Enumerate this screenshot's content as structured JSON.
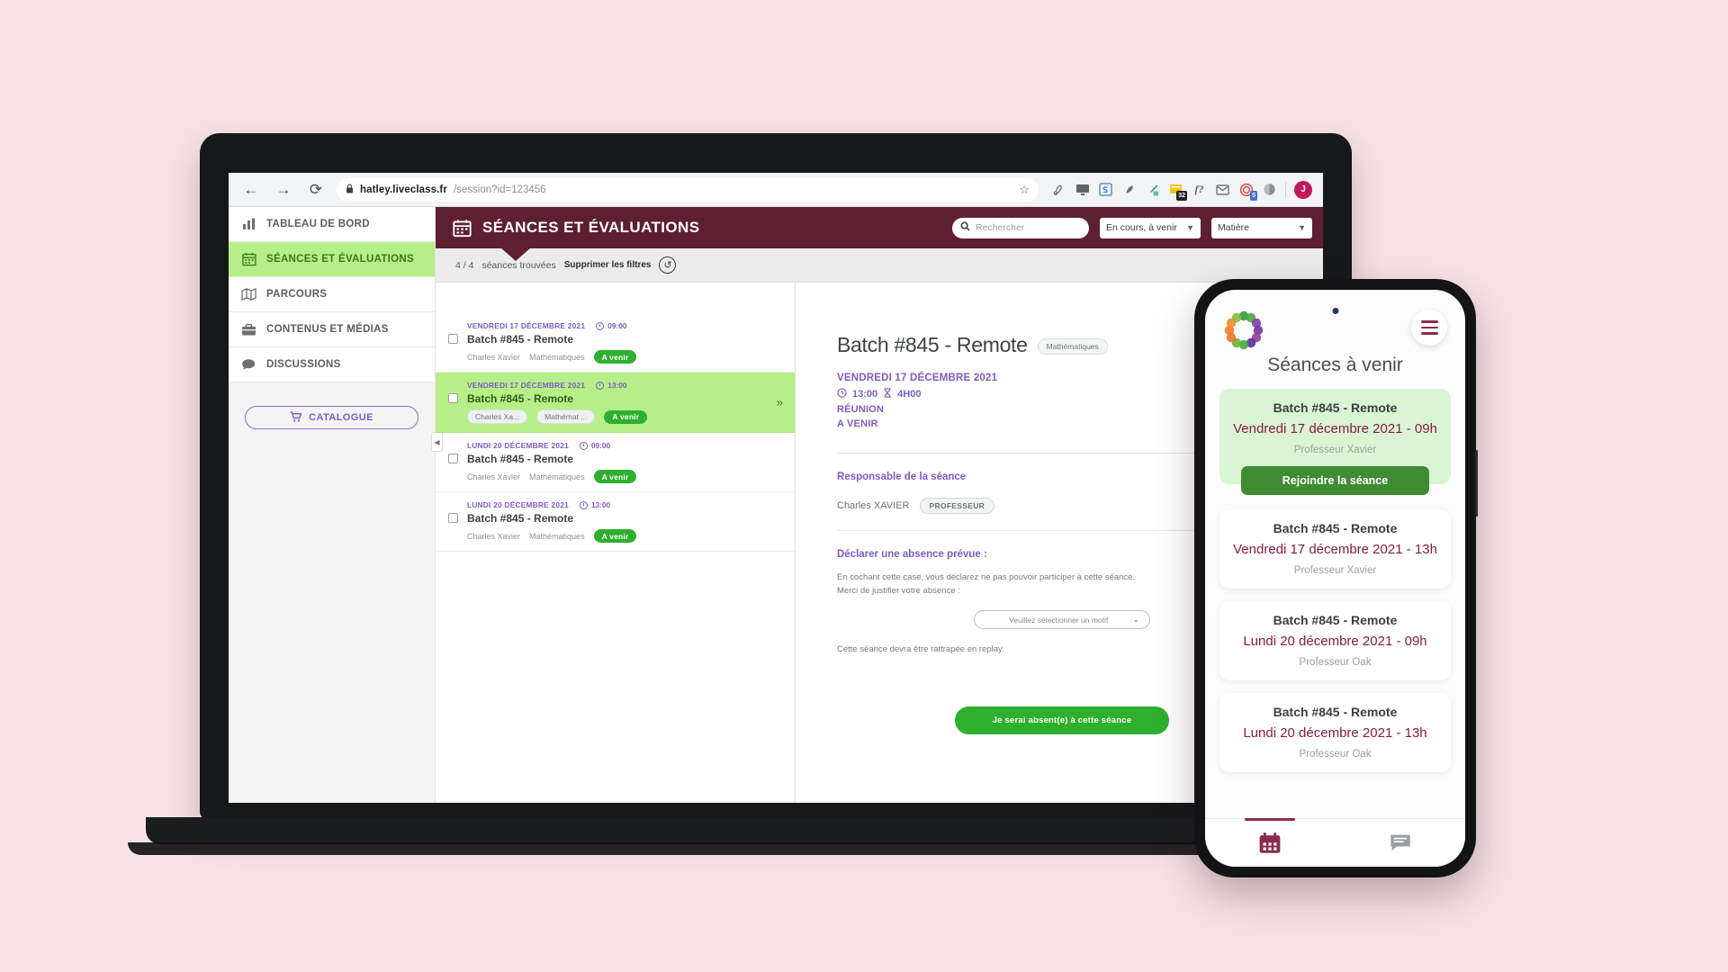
{
  "browser": {
    "url_host": "hatley.liveclass.fr",
    "url_path": "/session?id=123456",
    "back_icon": "←",
    "forward_icon": "→",
    "reload_icon": "⟳",
    "lock_icon": "🔒",
    "star_icon": "☆",
    "profile_initial": "J",
    "extension_badge_count": "5",
    "extension_note_count": "32"
  },
  "sidebar": {
    "items": [
      {
        "label": "TABLEAU DE BORD",
        "icon": "bar-chart-icon",
        "active": false
      },
      {
        "label": "SÉANCES ET ÉVALUATIONS",
        "icon": "calendar-icon",
        "active": true
      },
      {
        "label": "PARCOURS",
        "icon": "map-icon",
        "active": false
      },
      {
        "label": "CONTENUS ET MÉDIAS",
        "icon": "briefcase-icon",
        "active": false
      },
      {
        "label": "DISCUSSIONS",
        "icon": "chat-icon",
        "active": false
      }
    ],
    "catalogue_label": "CATALOGUE",
    "collapse_icon": "◀"
  },
  "topbar": {
    "title": "SÉANCES ET ÉVALUATIONS",
    "calendar_icon": "calendar-icon",
    "search_placeholder": "Rechercher",
    "search_value": "",
    "filter_status": "En cours, à venir",
    "filter_subject": "Matière"
  },
  "filterbar": {
    "count": "4 / 4",
    "count_label": "séances trouvées",
    "clear_label": "Supprimer les filtres",
    "reset_icon": "↺"
  },
  "sessions": [
    {
      "date": "VENDREDI 17 DÉCEMBRE 2021",
      "time": "09:00",
      "title": "Batch #845 - Remote",
      "teacher": "Charles Xavier",
      "subject": "Mathématiques",
      "status": "A venir",
      "selected": false
    },
    {
      "date": "VENDREDI 17 DÉCEMBRE 2021",
      "time": "13:00",
      "title": "Batch #845 - Remote",
      "teacher": "Charles Xa...",
      "subject": "Mathémat ...",
      "status": "A venir",
      "selected": true
    },
    {
      "date": "LUNDI 20 DÉCEMBRE 2021",
      "time": "09:00",
      "title": "Batch #845 - Remote",
      "teacher": "Charles Xavier",
      "subject": "Mathématiques",
      "status": "A venir",
      "selected": false
    },
    {
      "date": "LUNDI 20 DÉCEMBRE 2021",
      "time": "13:00",
      "title": "Batch #845 - Remote",
      "teacher": "Charles Xavier",
      "subject": "Mathématiques",
      "status": "A venir",
      "selected": false
    }
  ],
  "detail": {
    "title": "Batch #845 - Remote",
    "subject_badge": "Mathématiques",
    "date": "VENDREDI 17 DÉCEMBRE 2021",
    "time": "13:00",
    "duration": "4H00",
    "type": "RÉUNION",
    "status": "A VENIR",
    "responsable_heading": "Responsable de la séance",
    "responsable_name": "Charles XAVIER",
    "responsable_role": "PROFESSEUR",
    "absence_heading": "Déclarer une absence prévue :",
    "absence_text_line1": "En cochant cette case, vous déclarez ne pas pouvoir participer à cette séance.",
    "absence_text_line2": "Merci de justifier votre absence :",
    "motif_placeholder": "Veuillez sélectionner un motif",
    "replay_note": "Cette séance devra être rattrapée en replay.",
    "cta_label": "Je serai absent(e) à cette séance"
  },
  "phone": {
    "title": "Séances à venir",
    "menu_icon": "hamburger-icon",
    "logo_icon": "flower-logo-icon",
    "cards": [
      {
        "title": "Batch #845 - Remote",
        "date": "Vendredi 17 décembre 2021 - 09h",
        "teacher": "Professeur Xavier",
        "join_label": "Rejoindre la séance",
        "live": true
      },
      {
        "title": "Batch #845 - Remote",
        "date": "Vendredi 17 décembre 2021 - 13h",
        "teacher": "Professeur Xavier",
        "live": false
      },
      {
        "title": "Batch #845 - Remote",
        "date": "Lundi 20 décembre 2021 - 09h",
        "teacher": "Professeur Oak",
        "live": false
      },
      {
        "title": "Batch #845 - Remote",
        "date": "Lundi 20 décembre 2021 - 13h",
        "teacher": "Professeur Oak",
        "live": false
      }
    ],
    "nav": [
      {
        "icon": "calendar-icon",
        "active": true
      },
      {
        "icon": "chat-icon",
        "active": false
      }
    ]
  },
  "colors": {
    "brand_dark": "#5e1f32",
    "accent_green": "#2eb02e",
    "highlight_green": "#b6ef87",
    "purple": "#7c5cc4",
    "page_bg": "#f6e2e6"
  }
}
